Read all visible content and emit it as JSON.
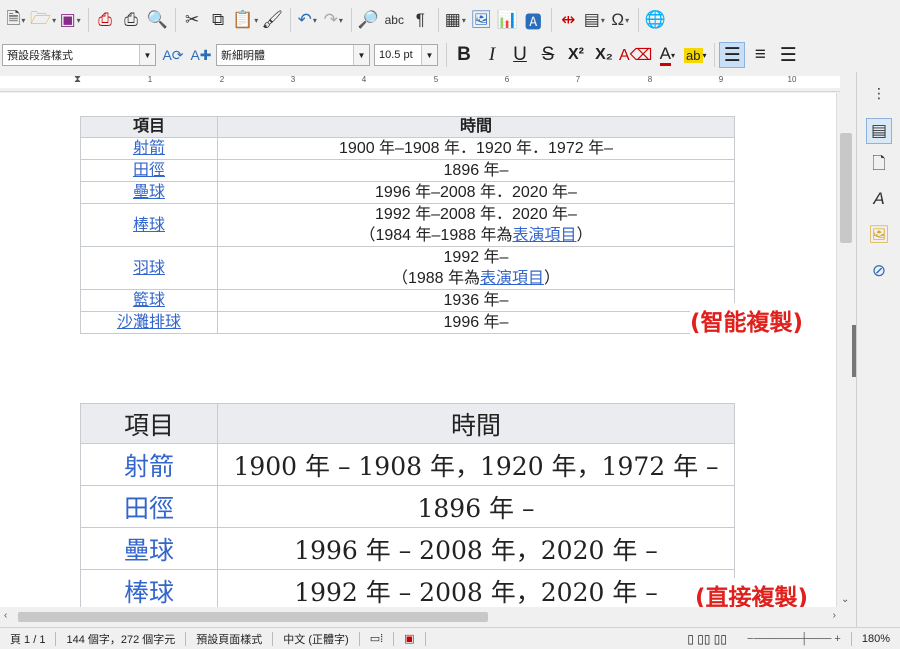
{
  "toolbar": {
    "paragraph_style": "預設段落樣式",
    "font_name": "新細明體",
    "font_size": "10.5 pt",
    "icons": [
      "new-document-icon",
      "open-folder-icon",
      "save-icon",
      "export-pdf-icon",
      "print-icon",
      "print-preview-icon",
      "cut-icon",
      "copy-icon",
      "paste-icon",
      "clone-formatting-icon",
      "undo-icon",
      "redo-icon",
      "find-replace-icon",
      "spelling-icon",
      "formatting-marks-icon",
      "insert-table-icon",
      "insert-image-icon",
      "insert-chart-icon",
      "insert-textbox-icon",
      "page-break-icon",
      "insert-field-icon",
      "special-character-icon",
      "hyperlink-icon"
    ],
    "spelling_label": "abc",
    "omega_label": "Ω"
  },
  "format": {
    "bold": "B",
    "italic": "I",
    "underline": "U",
    "strike": "S",
    "superscript": "X²",
    "subscript": "X₂"
  },
  "ruler": {
    "ticks": [
      "1",
      "2",
      "3",
      "4",
      "5",
      "6",
      "7",
      "8",
      "9",
      "10"
    ]
  },
  "small_table": {
    "headers": [
      "項目",
      "時間"
    ],
    "rows": [
      {
        "item": "射箭",
        "time": "1900 年–1908 年．1920 年．1972 年–"
      },
      {
        "item": "田徑",
        "time": "1896 年–"
      },
      {
        "item": "壘球",
        "time": "1996 年–2008 年．2020 年–"
      },
      {
        "item": "棒球",
        "time": "1992 年–2008 年．2020 年–",
        "time2_pre": "（1984 年–1988 年為",
        "time2_link": "表演項目",
        "time2_post": "）"
      },
      {
        "item": "羽球",
        "time": "1992 年–",
        "time2_pre": "（1988 年為",
        "time2_link": "表演項目",
        "time2_post": "）"
      },
      {
        "item": "籃球",
        "time": "1936 年–"
      },
      {
        "item": "沙灘排球",
        "time": "1996 年–"
      }
    ]
  },
  "large_table": {
    "headers": [
      "項目",
      "時間"
    ],
    "rows": [
      {
        "item": "射箭",
        "time": "1900 年 – 1908 年，1920 年，1972 年 –"
      },
      {
        "item": "田徑",
        "time": "1896 年 –"
      },
      {
        "item": "壘球",
        "time": "1996 年 – 2008 年，2020 年 –"
      },
      {
        "item": "棒球",
        "time": "1992 年 – 2008 年，2020 年 –"
      }
    ]
  },
  "labels": {
    "smart_copy": "(智能複製)",
    "direct_copy": "(直接複製)"
  },
  "status": {
    "page": "頁 1 / 1",
    "counts": "144 個字，272 個字元",
    "page_style": "預設頁面樣式",
    "language": "中文 (正體字)",
    "zoom": "180%"
  },
  "colors": {
    "link": "#3366cc",
    "label_red": "#e0201c",
    "header_bg": "#eaecf0"
  }
}
